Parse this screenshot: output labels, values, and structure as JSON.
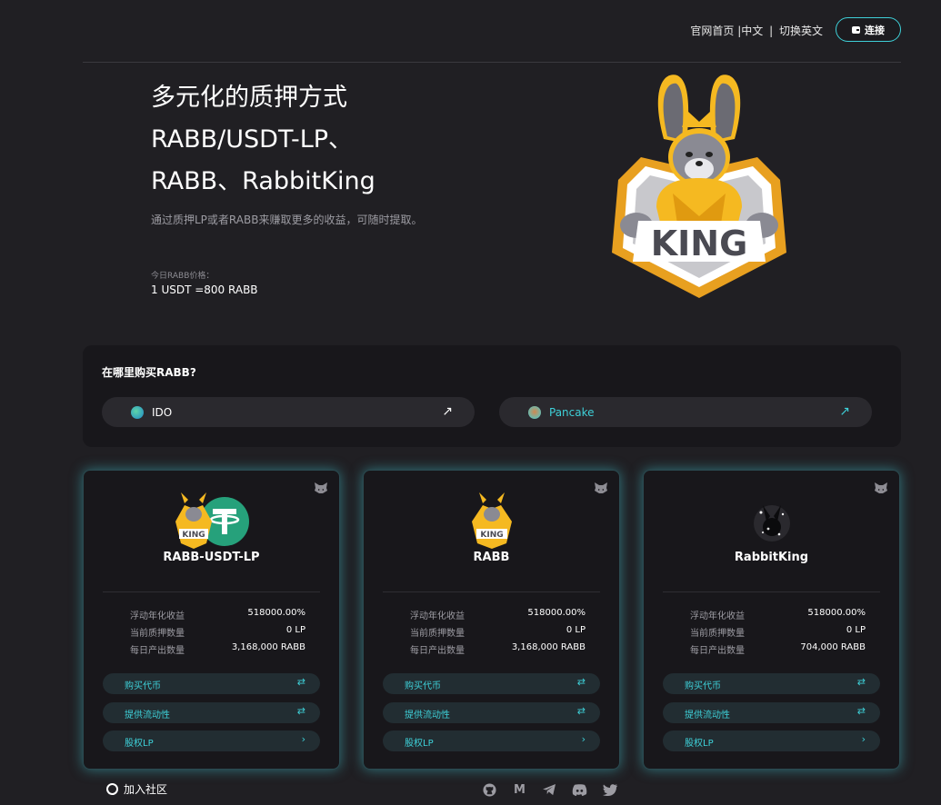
{
  "header": {
    "nav_home": "官网首页",
    "nav_chinese": "|中文",
    "nav_sep": "|",
    "nav_english": "切换英文",
    "connect_label": "连接"
  },
  "hero": {
    "title_line1": "多元化的质押方式",
    "title_line2": "RABB/USDT-LP、",
    "title_line3": "RABB、RabbitKing",
    "subtitle": "通过质押LP或者RABB来赚取更多的收益，可随时提取。",
    "price_label": "今日RABB价格：",
    "price_value": "1 USDT =800 RABB",
    "mascot_text": "KING"
  },
  "buy": {
    "title": "在哪里购买RABB?",
    "options": [
      {
        "label": "IDO",
        "color": "#ffffff",
        "arrow": "↗"
      },
      {
        "label": "Pancake",
        "color": "#3ed0d8",
        "arrow": "↗"
      }
    ]
  },
  "pools": [
    {
      "name": "RABB-USDT-LP",
      "stats": [
        {
          "label": "浮动年化收益",
          "value": "518000.00%"
        },
        {
          "label": "当前质押数量",
          "value": "0 LP"
        },
        {
          "label": "每日产出数量",
          "value": "3,168,000 RABB"
        }
      ],
      "actions": [
        {
          "label": "购买代币",
          "icon": "swap-icon"
        },
        {
          "label": "提供流动性",
          "icon": "swap-icon"
        },
        {
          "label": "股权LP",
          "icon": "chevron-right-icon"
        }
      ]
    },
    {
      "name": "RABB",
      "stats": [
        {
          "label": "浮动年化收益",
          "value": "518000.00%"
        },
        {
          "label": "当前质押数量",
          "value": "0 LP"
        },
        {
          "label": "每日产出数量",
          "value": "3,168,000 RABB"
        }
      ],
      "actions": [
        {
          "label": "购买代币",
          "icon": "swap-icon"
        },
        {
          "label": "提供流动性",
          "icon": "swap-icon"
        },
        {
          "label": "股权LP",
          "icon": "chevron-right-icon"
        }
      ]
    },
    {
      "name": "RabbitKing",
      "stats": [
        {
          "label": "浮动年化收益",
          "value": "518000.00%"
        },
        {
          "label": "当前质押数量",
          "value": "0 LP"
        },
        {
          "label": "每日产出数量",
          "value": "704,000 RABB"
        }
      ],
      "actions": [
        {
          "label": "购买代币",
          "icon": "swap-icon"
        },
        {
          "label": "提供流动性",
          "icon": "swap-icon"
        },
        {
          "label": "股权LP",
          "icon": "chevron-right-icon"
        }
      ]
    }
  ],
  "footer": {
    "community_label": "加入社区",
    "social_icons": [
      "github-icon",
      "medium-icon",
      "telegram-icon",
      "discord-icon",
      "twitter-icon"
    ],
    "medium_glyph": "M"
  },
  "colors": {
    "accent": "#3ed0d8",
    "background": "#201f23",
    "panel": "#18171b",
    "mascot_gold": "#f5b921",
    "tether_green": "#26a17b"
  }
}
